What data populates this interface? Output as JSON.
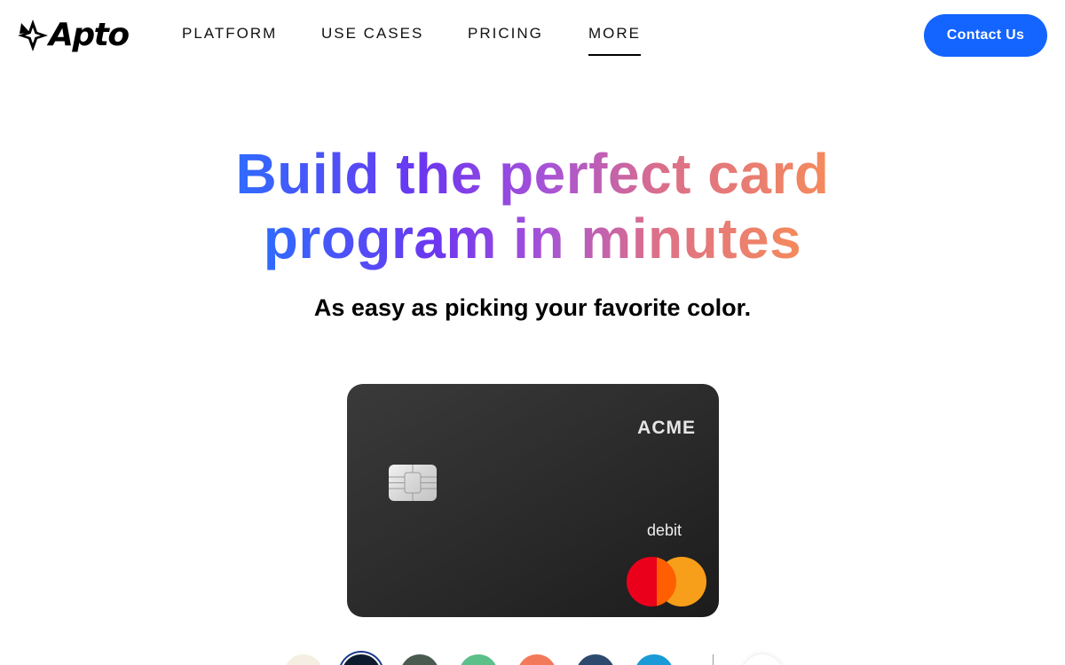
{
  "header": {
    "logo_text": "Apto",
    "nav": [
      {
        "label": "PLATFORM",
        "active": false
      },
      {
        "label": "USE CASES",
        "active": false
      },
      {
        "label": "PRICING",
        "active": false
      },
      {
        "label": "MORE",
        "active": true
      }
    ],
    "contact_button": "Contact Us"
  },
  "hero": {
    "headline_line1": "Build the perfect card",
    "headline_line2": "program in minutes",
    "subhead": "As easy as picking your favorite color."
  },
  "card": {
    "brand": "ACME",
    "type": "debit",
    "network_icon": "mastercard-logo",
    "chip_icon": "emv-chip",
    "color": "#2a2a2a"
  },
  "swatches": {
    "colors": [
      "#f4efe2",
      "#0d1b2e",
      "#4a5a4f",
      "#5bbf8a",
      "#f27a5a",
      "#2d4a6e",
      "#1a9ad6"
    ],
    "selected_index": 1
  },
  "colors": {
    "accent": "#1464ff",
    "gradient_start": "#2f6bff",
    "gradient_end": "#f58a5c"
  }
}
